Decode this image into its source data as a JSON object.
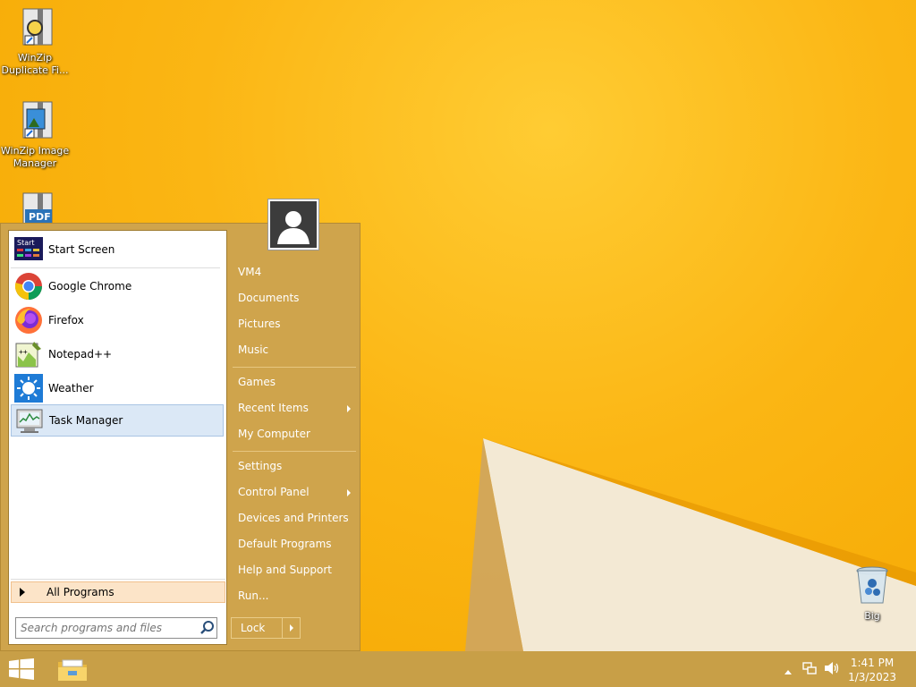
{
  "desktop": {
    "icons": [
      {
        "label": "WinZip Duplicate Fi...",
        "icon": "winzip-duplicate-finder-icon"
      },
      {
        "label": "WinZip Image Manager",
        "icon": "winzip-image-manager-icon"
      },
      {
        "label": "PDF",
        "icon": "pdf-icon"
      },
      {
        "label": "Big",
        "icon": "recycle-bin-icon"
      }
    ]
  },
  "start_menu": {
    "programs": [
      {
        "label": "Start Screen",
        "icon": "start-screen-icon"
      },
      {
        "label": "Google Chrome",
        "icon": "chrome-icon"
      },
      {
        "label": "Firefox",
        "icon": "firefox-icon"
      },
      {
        "label": "Notepad++",
        "icon": "notepad-plus-plus-icon"
      },
      {
        "label": "Weather",
        "icon": "weather-icon"
      },
      {
        "label": "Task Manager",
        "icon": "task-manager-icon",
        "selected": true
      }
    ],
    "start_icon_text": "Start",
    "all_programs_label": "All Programs",
    "search_placeholder": "Search programs and files",
    "right_items": [
      {
        "label": "VM4"
      },
      {
        "label": "Documents"
      },
      {
        "label": "Pictures"
      },
      {
        "label": "Music"
      },
      {
        "label": "Games"
      },
      {
        "label": "Recent Items",
        "submenu": true
      },
      {
        "label": "My Computer"
      },
      {
        "label": "Settings"
      },
      {
        "label": "Control Panel",
        "submenu": true
      },
      {
        "label": "Devices and Printers"
      },
      {
        "label": "Default Programs"
      },
      {
        "label": "Help and Support"
      },
      {
        "label": "Run..."
      }
    ],
    "lock_label": "Lock",
    "avatar_icon": "user-avatar-icon"
  },
  "taskbar": {
    "time": "1:41 PM",
    "date": "1/3/2023",
    "tray_icons": [
      "show-hidden-icons-chevron",
      "network-icon",
      "volume-icon"
    ],
    "pinned": [
      "start-button-windows-logo",
      "file-explorer-icon"
    ]
  },
  "colors": {
    "start_menu_bg": "#cfa44c",
    "taskbar_bg": "#c89f47",
    "desktop_bg": "#fbb614"
  }
}
